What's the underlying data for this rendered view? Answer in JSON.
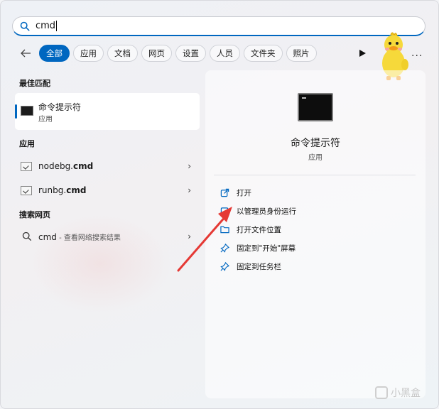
{
  "search": {
    "query": "cmd"
  },
  "filters": [
    "全部",
    "应用",
    "文档",
    "网页",
    "设置",
    "人员",
    "文件夹",
    "照片"
  ],
  "more_label": "···",
  "sections": {
    "best_match": "最佳匹配",
    "apps": "应用",
    "web": "搜索网页"
  },
  "best_match": {
    "name": "命令提示符",
    "type": "应用"
  },
  "apps": [
    {
      "name_plain": "nodebg.",
      "name_bold": "cmd"
    },
    {
      "name_plain": "runbg.",
      "name_bold": "cmd"
    }
  ],
  "web_search": {
    "query": "cmd",
    "hint": " - 查看网络搜索结果"
  },
  "detail": {
    "title": "命令提示符",
    "subtitle": "应用",
    "actions": [
      "打开",
      "以管理员身份运行",
      "打开文件位置",
      "固定到\"开始\"屏幕",
      "固定到任务栏"
    ]
  },
  "colors": {
    "accent": "#0067c0",
    "annotation_arrow": "#e53935"
  },
  "watermark": "小黑盒"
}
